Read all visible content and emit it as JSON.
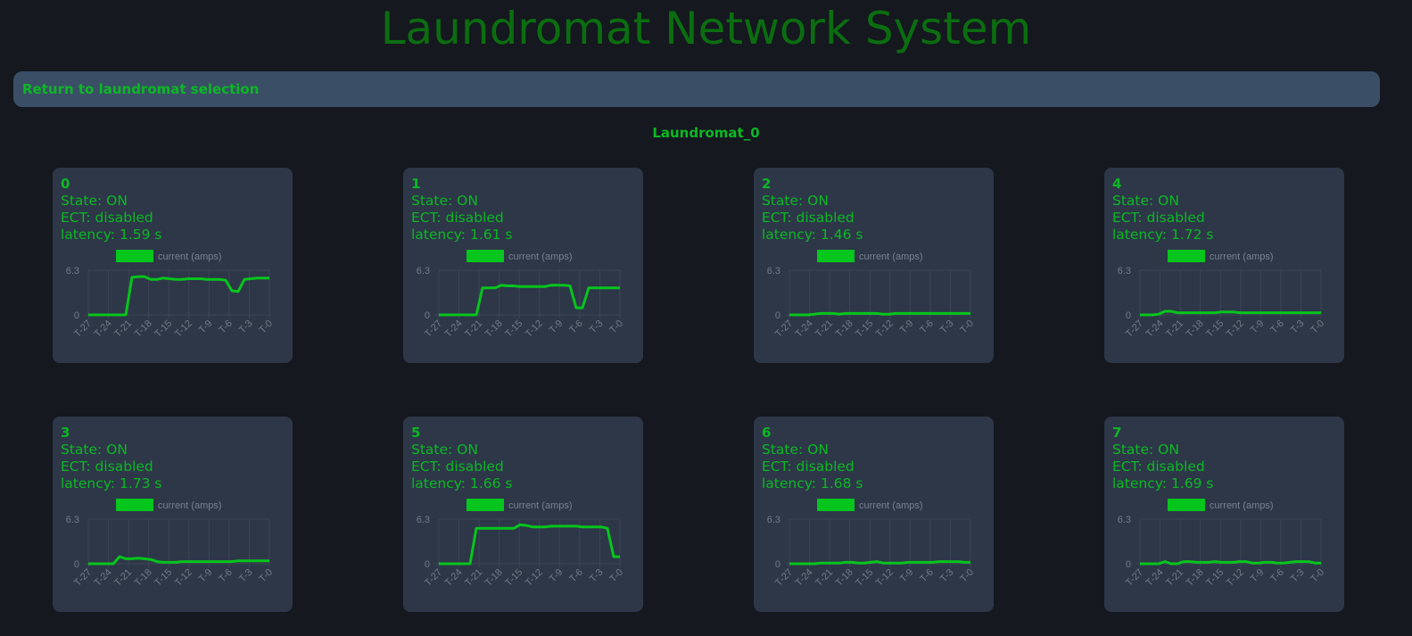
{
  "app": {
    "title": "Laundromat Network System",
    "back_button_label": "Return to laundromat selection",
    "laundromat_name": "Laundromat_0"
  },
  "colors": {
    "background": "#15181f",
    "card": "#2d3748",
    "accent_green": "#06c51c",
    "text_green": "#0bb823",
    "title_green": "#0b6d10",
    "button_bg": "#3a4f66"
  },
  "machines": [
    {
      "id": "0",
      "state": "State: ON",
      "ect": "ECT: disabled",
      "latency": "latency: 1.59 s"
    },
    {
      "id": "1",
      "state": "State: ON",
      "ect": "ECT: disabled",
      "latency": "latency: 1.61 s"
    },
    {
      "id": "2",
      "state": "State: ON",
      "ect": "ECT: disabled",
      "latency": "latency: 1.46 s"
    },
    {
      "id": "4",
      "state": "State: ON",
      "ect": "ECT: disabled",
      "latency": "latency: 1.72 s"
    },
    {
      "id": "3",
      "state": "State: ON",
      "ect": "ECT: disabled",
      "latency": "latency: 1.73 s"
    },
    {
      "id": "5",
      "state": "State: ON",
      "ect": "ECT: disabled",
      "latency": "latency: 1.66 s"
    },
    {
      "id": "6",
      "state": "State: ON",
      "ect": "ECT: disabled",
      "latency": "latency: 1.68 s"
    },
    {
      "id": "7",
      "state": "State: ON",
      "ect": "ECT: disabled",
      "latency": "latency: 1.69 s"
    }
  ],
  "chart_data": [
    {
      "type": "line",
      "machine": "0",
      "legend": "current (amps)",
      "series": [
        {
          "name": "current (amps)",
          "values": [
            0,
            0,
            0,
            0,
            0,
            0,
            0,
            5.3,
            5.4,
            5.4,
            5.0,
            5.0,
            5.2,
            5.1,
            5.0,
            5.0,
            5.1,
            5.1,
            5.1,
            5.0,
            5.0,
            5.0,
            4.9,
            3.4,
            3.3,
            5.0,
            5.1,
            5.2,
            5.2,
            5.2
          ]
        }
      ],
      "x_ticks": [
        "T-27",
        "T-24",
        "T-21",
        "T-18",
        "T-15",
        "T-12",
        "T-9",
        "T-6",
        "T-3",
        "T-0"
      ],
      "y_ticks": [
        "0",
        "6.3"
      ],
      "ylim": [
        0,
        6.3
      ]
    },
    {
      "type": "line",
      "machine": "1",
      "legend": "current (amps)",
      "series": [
        {
          "name": "current (amps)",
          "values": [
            0,
            0,
            0,
            0,
            0,
            0,
            0,
            3.8,
            3.8,
            3.8,
            4.2,
            4.1,
            4.1,
            4.0,
            4.0,
            4.0,
            4.0,
            4.0,
            4.2,
            4.2,
            4.2,
            4.1,
            1.0,
            1.0,
            3.8,
            3.8,
            3.8,
            3.8,
            3.8,
            3.8
          ]
        }
      ],
      "x_ticks": [
        "T-27",
        "T-24",
        "T-21",
        "T-18",
        "T-15",
        "T-12",
        "T-9",
        "T-6",
        "T-3",
        "T-0"
      ],
      "y_ticks": [
        "0",
        "6.3"
      ],
      "ylim": [
        0,
        6.3
      ]
    },
    {
      "type": "line",
      "machine": "2",
      "legend": "current (amps)",
      "series": [
        {
          "name": "current (amps)",
          "values": [
            0,
            0,
            0,
            0,
            0.1,
            0.2,
            0.2,
            0.2,
            0.1,
            0.2,
            0.2,
            0.2,
            0.2,
            0.2,
            0.2,
            0.1,
            0.1,
            0.2,
            0.2,
            0.2,
            0.2,
            0.2,
            0.2,
            0.2,
            0.2,
            0.2,
            0.2,
            0.2,
            0.2,
            0.2
          ]
        }
      ],
      "x_ticks": [
        "T-27",
        "T-24",
        "T-21",
        "T-18",
        "T-15",
        "T-12",
        "T-9",
        "T-6",
        "T-3",
        "T-0"
      ],
      "y_ticks": [
        "0",
        "6.3"
      ],
      "ylim": [
        0,
        6.3
      ]
    },
    {
      "type": "line",
      "machine": "4",
      "legend": "current (amps)",
      "series": [
        {
          "name": "current (amps)",
          "values": [
            0,
            0,
            0,
            0.1,
            0.5,
            0.5,
            0.3,
            0.3,
            0.3,
            0.3,
            0.3,
            0.3,
            0.3,
            0.4,
            0.4,
            0.4,
            0.3,
            0.3,
            0.3,
            0.3,
            0.3,
            0.3,
            0.3,
            0.3,
            0.3,
            0.3,
            0.3,
            0.3,
            0.3,
            0.3
          ]
        }
      ],
      "x_ticks": [
        "T-27",
        "T-24",
        "T-21",
        "T-18",
        "T-15",
        "T-12",
        "T-9",
        "T-6",
        "T-3",
        "T-0"
      ],
      "y_ticks": [
        "0",
        "6.3"
      ],
      "ylim": [
        0,
        6.3
      ]
    },
    {
      "type": "line",
      "machine": "3",
      "legend": "current (amps)",
      "series": [
        {
          "name": "current (amps)",
          "values": [
            0,
            0,
            0,
            0,
            0,
            1.0,
            0.7,
            0.7,
            0.8,
            0.7,
            0.6,
            0.3,
            0.2,
            0.2,
            0.2,
            0.3,
            0.3,
            0.3,
            0.3,
            0.3,
            0.3,
            0.3,
            0.3,
            0.3,
            0.4,
            0.4,
            0.4,
            0.4,
            0.4,
            0.4
          ]
        }
      ],
      "x_ticks": [
        "T-27",
        "T-24",
        "T-21",
        "T-18",
        "T-15",
        "T-12",
        "T-9",
        "T-6",
        "T-3",
        "T-0"
      ],
      "y_ticks": [
        "0",
        "6.3"
      ],
      "ylim": [
        0,
        6.3
      ]
    },
    {
      "type": "line",
      "machine": "5",
      "legend": "current (amps)",
      "series": [
        {
          "name": "current (amps)",
          "values": [
            0,
            0,
            0,
            0,
            0,
            0,
            5.0,
            5.0,
            5.0,
            5.0,
            5.0,
            5.0,
            5.0,
            5.5,
            5.4,
            5.2,
            5.2,
            5.2,
            5.3,
            5.3,
            5.3,
            5.3,
            5.3,
            5.2,
            5.2,
            5.2,
            5.2,
            5.0,
            1.0,
            1.0
          ]
        }
      ],
      "x_ticks": [
        "T-27",
        "T-24",
        "T-21",
        "T-18",
        "T-15",
        "T-12",
        "T-9",
        "T-6",
        "T-3",
        "T-0"
      ],
      "y_ticks": [
        "0",
        "6.3"
      ],
      "ylim": [
        0,
        6.3
      ]
    },
    {
      "type": "line",
      "machine": "6",
      "legend": "current (amps)",
      "series": [
        {
          "name": "current (amps)",
          "values": [
            0,
            0,
            0,
            0,
            0,
            0.1,
            0.1,
            0.1,
            0.1,
            0.2,
            0.2,
            0.1,
            0.1,
            0.2,
            0.3,
            0.1,
            0.1,
            0.1,
            0.1,
            0.2,
            0.2,
            0.2,
            0.2,
            0.2,
            0.3,
            0.3,
            0.3,
            0.3,
            0.2,
            0.2
          ]
        }
      ],
      "x_ticks": [
        "T-27",
        "T-24",
        "T-21",
        "T-18",
        "T-15",
        "T-12",
        "T-9",
        "T-6",
        "T-3",
        "T-0"
      ],
      "y_ticks": [
        "0",
        "6.3"
      ],
      "ylim": [
        0,
        6.3
      ]
    },
    {
      "type": "line",
      "machine": "7",
      "legend": "current (amps)",
      "series": [
        {
          "name": "current (amps)",
          "values": [
            0,
            0,
            0,
            0,
            0.3,
            0.0,
            0.0,
            0.3,
            0.3,
            0.2,
            0.2,
            0.2,
            0.3,
            0.2,
            0.2,
            0.2,
            0.3,
            0.3,
            0.1,
            0.1,
            0.2,
            0.2,
            0.1,
            0.1,
            0.2,
            0.3,
            0.3,
            0.3,
            0.1,
            0.1
          ]
        }
      ],
      "x_ticks": [
        "T-27",
        "T-24",
        "T-21",
        "T-18",
        "T-15",
        "T-12",
        "T-9",
        "T-6",
        "T-3",
        "T-0"
      ],
      "y_ticks": [
        "0",
        "6.3"
      ],
      "ylim": [
        0,
        6.3
      ]
    }
  ]
}
